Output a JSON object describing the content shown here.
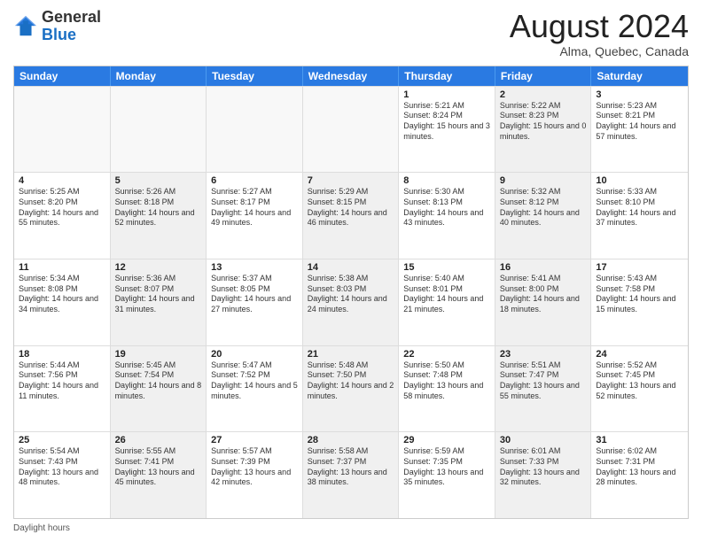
{
  "header": {
    "logo_general": "General",
    "logo_blue": "Blue",
    "month_year": "August 2024",
    "location": "Alma, Quebec, Canada"
  },
  "days_of_week": [
    "Sunday",
    "Monday",
    "Tuesday",
    "Wednesday",
    "Thursday",
    "Friday",
    "Saturday"
  ],
  "weeks": [
    [
      {
        "day": "",
        "info": "",
        "shaded": false,
        "empty": true
      },
      {
        "day": "",
        "info": "",
        "shaded": false,
        "empty": true
      },
      {
        "day": "",
        "info": "",
        "shaded": false,
        "empty": true
      },
      {
        "day": "",
        "info": "",
        "shaded": false,
        "empty": true
      },
      {
        "day": "1",
        "info": "Sunrise: 5:21 AM\nSunset: 8:24 PM\nDaylight: 15 hours and 3 minutes.",
        "shaded": false,
        "empty": false
      },
      {
        "day": "2",
        "info": "Sunrise: 5:22 AM\nSunset: 8:23 PM\nDaylight: 15 hours and 0 minutes.",
        "shaded": true,
        "empty": false
      },
      {
        "day": "3",
        "info": "Sunrise: 5:23 AM\nSunset: 8:21 PM\nDaylight: 14 hours and 57 minutes.",
        "shaded": false,
        "empty": false
      }
    ],
    [
      {
        "day": "4",
        "info": "Sunrise: 5:25 AM\nSunset: 8:20 PM\nDaylight: 14 hours and 55 minutes.",
        "shaded": false,
        "empty": false
      },
      {
        "day": "5",
        "info": "Sunrise: 5:26 AM\nSunset: 8:18 PM\nDaylight: 14 hours and 52 minutes.",
        "shaded": true,
        "empty": false
      },
      {
        "day": "6",
        "info": "Sunrise: 5:27 AM\nSunset: 8:17 PM\nDaylight: 14 hours and 49 minutes.",
        "shaded": false,
        "empty": false
      },
      {
        "day": "7",
        "info": "Sunrise: 5:29 AM\nSunset: 8:15 PM\nDaylight: 14 hours and 46 minutes.",
        "shaded": true,
        "empty": false
      },
      {
        "day": "8",
        "info": "Sunrise: 5:30 AM\nSunset: 8:13 PM\nDaylight: 14 hours and 43 minutes.",
        "shaded": false,
        "empty": false
      },
      {
        "day": "9",
        "info": "Sunrise: 5:32 AM\nSunset: 8:12 PM\nDaylight: 14 hours and 40 minutes.",
        "shaded": true,
        "empty": false
      },
      {
        "day": "10",
        "info": "Sunrise: 5:33 AM\nSunset: 8:10 PM\nDaylight: 14 hours and 37 minutes.",
        "shaded": false,
        "empty": false
      }
    ],
    [
      {
        "day": "11",
        "info": "Sunrise: 5:34 AM\nSunset: 8:08 PM\nDaylight: 14 hours and 34 minutes.",
        "shaded": false,
        "empty": false
      },
      {
        "day": "12",
        "info": "Sunrise: 5:36 AM\nSunset: 8:07 PM\nDaylight: 14 hours and 31 minutes.",
        "shaded": true,
        "empty": false
      },
      {
        "day": "13",
        "info": "Sunrise: 5:37 AM\nSunset: 8:05 PM\nDaylight: 14 hours and 27 minutes.",
        "shaded": false,
        "empty": false
      },
      {
        "day": "14",
        "info": "Sunrise: 5:38 AM\nSunset: 8:03 PM\nDaylight: 14 hours and 24 minutes.",
        "shaded": true,
        "empty": false
      },
      {
        "day": "15",
        "info": "Sunrise: 5:40 AM\nSunset: 8:01 PM\nDaylight: 14 hours and 21 minutes.",
        "shaded": false,
        "empty": false
      },
      {
        "day": "16",
        "info": "Sunrise: 5:41 AM\nSunset: 8:00 PM\nDaylight: 14 hours and 18 minutes.",
        "shaded": true,
        "empty": false
      },
      {
        "day": "17",
        "info": "Sunrise: 5:43 AM\nSunset: 7:58 PM\nDaylight: 14 hours and 15 minutes.",
        "shaded": false,
        "empty": false
      }
    ],
    [
      {
        "day": "18",
        "info": "Sunrise: 5:44 AM\nSunset: 7:56 PM\nDaylight: 14 hours and 11 minutes.",
        "shaded": false,
        "empty": false
      },
      {
        "day": "19",
        "info": "Sunrise: 5:45 AM\nSunset: 7:54 PM\nDaylight: 14 hours and 8 minutes.",
        "shaded": true,
        "empty": false
      },
      {
        "day": "20",
        "info": "Sunrise: 5:47 AM\nSunset: 7:52 PM\nDaylight: 14 hours and 5 minutes.",
        "shaded": false,
        "empty": false
      },
      {
        "day": "21",
        "info": "Sunrise: 5:48 AM\nSunset: 7:50 PM\nDaylight: 14 hours and 2 minutes.",
        "shaded": true,
        "empty": false
      },
      {
        "day": "22",
        "info": "Sunrise: 5:50 AM\nSunset: 7:48 PM\nDaylight: 13 hours and 58 minutes.",
        "shaded": false,
        "empty": false
      },
      {
        "day": "23",
        "info": "Sunrise: 5:51 AM\nSunset: 7:47 PM\nDaylight: 13 hours and 55 minutes.",
        "shaded": true,
        "empty": false
      },
      {
        "day": "24",
        "info": "Sunrise: 5:52 AM\nSunset: 7:45 PM\nDaylight: 13 hours and 52 minutes.",
        "shaded": false,
        "empty": false
      }
    ],
    [
      {
        "day": "25",
        "info": "Sunrise: 5:54 AM\nSunset: 7:43 PM\nDaylight: 13 hours and 48 minutes.",
        "shaded": false,
        "empty": false
      },
      {
        "day": "26",
        "info": "Sunrise: 5:55 AM\nSunset: 7:41 PM\nDaylight: 13 hours and 45 minutes.",
        "shaded": true,
        "empty": false
      },
      {
        "day": "27",
        "info": "Sunrise: 5:57 AM\nSunset: 7:39 PM\nDaylight: 13 hours and 42 minutes.",
        "shaded": false,
        "empty": false
      },
      {
        "day": "28",
        "info": "Sunrise: 5:58 AM\nSunset: 7:37 PM\nDaylight: 13 hours and 38 minutes.",
        "shaded": true,
        "empty": false
      },
      {
        "day": "29",
        "info": "Sunrise: 5:59 AM\nSunset: 7:35 PM\nDaylight: 13 hours and 35 minutes.",
        "shaded": false,
        "empty": false
      },
      {
        "day": "30",
        "info": "Sunrise: 6:01 AM\nSunset: 7:33 PM\nDaylight: 13 hours and 32 minutes.",
        "shaded": true,
        "empty": false
      },
      {
        "day": "31",
        "info": "Sunrise: 6:02 AM\nSunset: 7:31 PM\nDaylight: 13 hours and 28 minutes.",
        "shaded": false,
        "empty": false
      }
    ]
  ],
  "footer": {
    "label": "Daylight hours"
  }
}
